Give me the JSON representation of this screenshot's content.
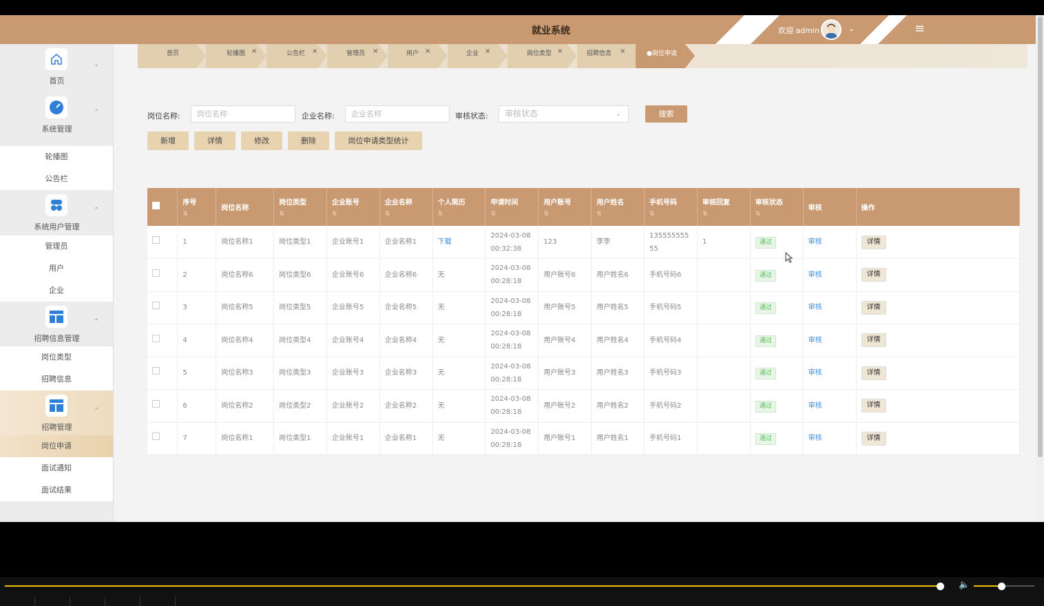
{
  "header": {
    "title": "就业系统",
    "welcome": "欢迎 admin",
    "caret": "⌄",
    "menu_icon": "≡"
  },
  "sidebar": {
    "home": {
      "label": "首页",
      "icon": "home-icon"
    },
    "groups": [
      {
        "label": "系统管理",
        "icon": "gauge-icon",
        "items": [
          "轮播图",
          "公告栏"
        ]
      },
      {
        "label": "系统用户管理",
        "icon": "user-group-icon",
        "items": [
          "管理员",
          "用户",
          "企业"
        ]
      },
      {
        "label": "招聘信息管理",
        "icon": "layout-icon",
        "items": [
          "岗位类型",
          "招聘信息"
        ]
      },
      {
        "label": "招聘管理",
        "icon": "layout-icon",
        "items": [
          "岗位申请",
          "面试通知",
          "面试结果"
        ],
        "active_item": "岗位申请"
      }
    ]
  },
  "tabs": [
    "首页",
    "轮播图",
    "公告栏",
    "管理员",
    "用户",
    "企业",
    "岗位类型",
    "招聘信息",
    "●岗位申请"
  ],
  "search": {
    "job_name_label": "岗位名称:",
    "job_name_placeholder": "岗位名称",
    "company_name_label": "企业名称:",
    "company_name_placeholder": "企业名称",
    "status_label": "审核状态:",
    "status_placeholder": "审核状态",
    "search_button": "搜索"
  },
  "toolbar": {
    "add": "新增",
    "detail": "详情",
    "edit": "修改",
    "delete": "删除",
    "stats": "岗位申请类型统计"
  },
  "table": {
    "columns": [
      "序号",
      "岗位名称",
      "岗位类型",
      "企业账号",
      "企业名称",
      "个人简历",
      "申请时间",
      "用户账号",
      "用户姓名",
      "手机号码",
      "审核回复",
      "审核状态",
      "审核",
      "操作"
    ],
    "rows": [
      {
        "no": "1",
        "job": "岗位名称1",
        "type": "岗位类型1",
        "acct": "企业账号1",
        "company": "企业名称1",
        "resume": "下载",
        "date": "2024-03-08",
        "time": "00:32:38",
        "user": "123",
        "uname": "李李",
        "phone": "135555555",
        "phone2": "55",
        "reply": "1",
        "status": "通过",
        "audit": "审核",
        "op": "详情"
      },
      {
        "no": "2",
        "job": "岗位名称6",
        "type": "岗位类型6",
        "acct": "企业账号6",
        "company": "企业名称6",
        "resume": "无",
        "date": "2024-03-08",
        "time": "00:28:18",
        "user": "用户账号6",
        "uname": "用户姓名6",
        "phone": "手机号码6",
        "phone2": "",
        "reply": "",
        "status": "通过",
        "audit": "审核",
        "op": "详情"
      },
      {
        "no": "3",
        "job": "岗位名称5",
        "type": "岗位类型5",
        "acct": "企业账号5",
        "company": "企业名称5",
        "resume": "无",
        "date": "2024-03-08",
        "time": "00:28:18",
        "user": "用户账号5",
        "uname": "用户姓名5",
        "phone": "手机号码5",
        "phone2": "",
        "reply": "",
        "status": "通过",
        "audit": "审核",
        "op": "详情"
      },
      {
        "no": "4",
        "job": "岗位名称4",
        "type": "岗位类型4",
        "acct": "企业账号4",
        "company": "企业名称4",
        "resume": "无",
        "date": "2024-03-08",
        "time": "00:28:18",
        "user": "用户账号4",
        "uname": "用户姓名4",
        "phone": "手机号码4",
        "phone2": "",
        "reply": "",
        "status": "通过",
        "audit": "审核",
        "op": "详情"
      },
      {
        "no": "5",
        "job": "岗位名称3",
        "type": "岗位类型3",
        "acct": "企业账号3",
        "company": "企业名称3",
        "resume": "无",
        "date": "2024-03-08",
        "time": "00:28:18",
        "user": "用户账号3",
        "uname": "用户姓名3",
        "phone": "手机号码3",
        "phone2": "",
        "reply": "",
        "status": "通过",
        "audit": "审核",
        "op": "详情"
      },
      {
        "no": "6",
        "job": "岗位名称2",
        "type": "岗位类型2",
        "acct": "企业账号2",
        "company": "企业名称2",
        "resume": "无",
        "date": "2024-03-08",
        "time": "00:28:18",
        "user": "用户账号2",
        "uname": "用户姓名2",
        "phone": "手机号码2",
        "phone2": "",
        "reply": "",
        "status": "通过",
        "audit": "审核",
        "op": "详情"
      },
      {
        "no": "7",
        "job": "岗位名称1",
        "type": "岗位类型1",
        "acct": "企业账号1",
        "company": "企业名称1",
        "resume": "无",
        "date": "2024-03-08",
        "time": "00:28:18",
        "user": "用户账号1",
        "uname": "用户姓名1",
        "phone": "手机号码1",
        "phone2": "",
        "reply": "",
        "status": "通过",
        "audit": "审核",
        "op": "详情"
      }
    ]
  },
  "video_player": {
    "progress": 0.995,
    "volume": 0.45
  },
  "colors": {
    "brand": "#c99a72",
    "accent": "#e8d3b1",
    "status_ok": "#5cb85c",
    "link": "#3a8ee6"
  }
}
